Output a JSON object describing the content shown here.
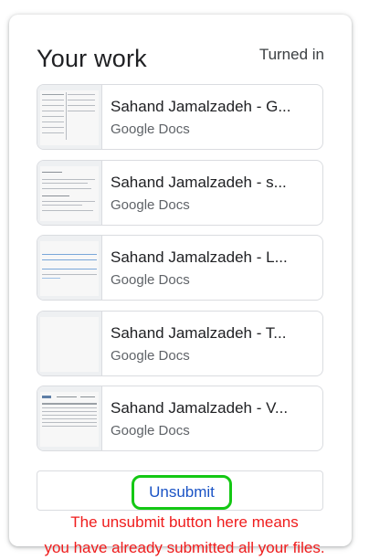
{
  "header": {
    "title": "Your work",
    "status": "Turned in"
  },
  "attachments": [
    {
      "name": "Sahand Jamalzadeh - G...",
      "type": "Google Docs",
      "thumb_icon": "doc-table-thumbnail"
    },
    {
      "name": "Sahand Jamalzadeh - s...",
      "type": "Google Docs",
      "thumb_icon": "doc-text-thumbnail"
    },
    {
      "name": "Sahand Jamalzadeh - L...",
      "type": "Google Docs",
      "thumb_icon": "doc-blue-lines-thumbnail"
    },
    {
      "name": "Sahand Jamalzadeh - T...",
      "type": "Google Docs",
      "thumb_icon": "doc-blank-thumbnail"
    },
    {
      "name": "Sahand Jamalzadeh - V...",
      "type": "Google Docs",
      "thumb_icon": "doc-table-header-thumbnail"
    }
  ],
  "actions": {
    "unsubmit_label": "Unsubmit"
  },
  "annotation": {
    "line1": "The unsubmit button here means",
    "line2": "you have already submitted all your files."
  },
  "colors": {
    "button_text": "#1a53c5",
    "highlight_outline": "#14c814",
    "annotation_text": "#ef1c1c"
  }
}
